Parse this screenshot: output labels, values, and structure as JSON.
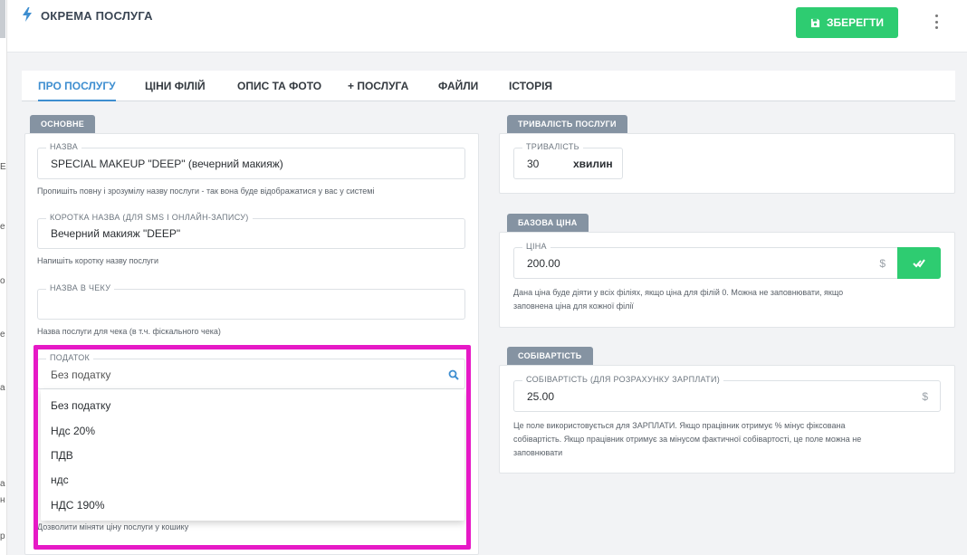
{
  "header": {
    "title": "ОКРЕМА ПОСЛУГА",
    "save_label": "ЗБЕРЕГТИ"
  },
  "tabs": [
    {
      "label": "ПРО ПОСЛУГУ",
      "active": true
    },
    {
      "label": "ЦІНИ ФІЛІЙ"
    },
    {
      "label": "ОПИС ТА ФОТО"
    },
    {
      "label": "+ ПОСЛУГА"
    },
    {
      "label": "ФАЙЛИ"
    },
    {
      "label": "ІСТОРІЯ"
    }
  ],
  "left_edge_glyphs": [
    "Е",
    "е",
    "о",
    "е",
    "а",
    "а",
    "н",
    "р"
  ],
  "basic": {
    "section_label": "ОСНОВНЕ",
    "name_label": "НАЗВА",
    "name_value": "SPECIAL MAKEUP \"DEEP\" (вечерний макияж)",
    "name_hint": "Пропишіть повну і зрозумілу назву послуги - так вона буде відображатися у вас у системі",
    "short_name_label": "КОРОТКА НАЗВА (ДЛЯ SMS І ОНЛАЙН-ЗАПИСУ)",
    "short_name_value": "Вечерний макияж \"DEEP\"",
    "short_name_hint": "Напишіть коротку назву послуги",
    "receipt_name_label": "НАЗВА В ЧЕКУ",
    "receipt_name_value": "",
    "receipt_name_hint": "Назва послуги для чека (в т.ч. фіскального чека)",
    "tax_label": "ПОДАТОК",
    "tax_placeholder": "Без податку",
    "tax_options": [
      "Без податку",
      "Ндс 20%",
      "ПДВ",
      "ндс",
      "НДС 190%"
    ],
    "cart_price_hint": "Дозволити міняти ціну послуги у кошику"
  },
  "duration": {
    "section_label": "ТРИВАЛІСТЬ ПОСЛУГИ",
    "field_label": "ТРИВАЛІСТЬ",
    "value": "30",
    "unit": "хвилин"
  },
  "base_price": {
    "section_label": "БАЗОВА ЦІНА",
    "field_label": "ЦІНА",
    "value": "200.00",
    "currency": "$",
    "hint_line1": "Дана ціна буде діяти у всіх філіях, якщо ціна для філій 0. Можна не заповнювати, якщо",
    "hint_line2": "заповнена ціна для кожної філії"
  },
  "cost": {
    "section_label": "СОБІВАРТІСТЬ",
    "field_label": "СОБІВАРТІСТЬ (ДЛЯ РОЗРАХУНКУ ЗАРПЛАТИ)",
    "value": "25.00",
    "currency": "$",
    "hint_line1": "Це поле використовується для ЗАРПЛАТИ. Якщо працівник отримує % мінус фіксована",
    "hint_line2": "собівартість. Якщо працівник отримує за мінусом фактичної собівартості, це поле можна не",
    "hint_line3": "заповнювати"
  },
  "colors": {
    "accent": "#3e8ed0",
    "success": "#2ecc71",
    "highlight": "#e619c6",
    "section_tag": "#8593a2"
  }
}
